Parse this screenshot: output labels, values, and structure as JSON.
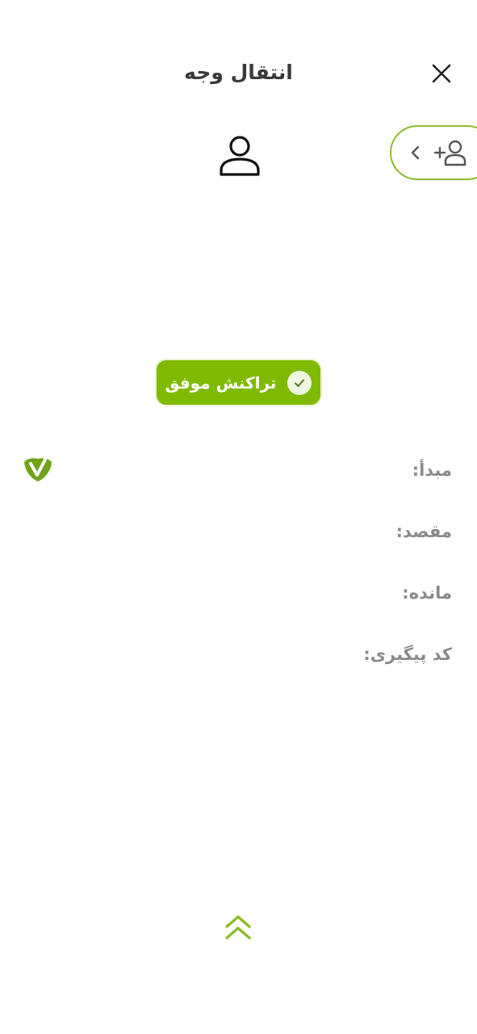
{
  "header": {
    "title": "انتقال وجه",
    "close_icon": "close-icon"
  },
  "recipient": {
    "avatar_icon": "person-icon"
  },
  "add_contact": {
    "icons": [
      "chevron-left-icon",
      "add-person-icon"
    ],
    "accent_color": "#8cbc2c"
  },
  "status": {
    "label": "تراکنش موفق",
    "icon": "check-circle-icon",
    "color": "#7fba00"
  },
  "details": {
    "source_label": "مبدأ:",
    "destination_label": "مقصد:",
    "balance_label": "مانده:",
    "tracking_label": "کد پیگیری:"
  },
  "bank": {
    "logo_icon": "bank-logo-icon"
  },
  "footer": {
    "expand_icon": "double-chevron-up-icon"
  }
}
